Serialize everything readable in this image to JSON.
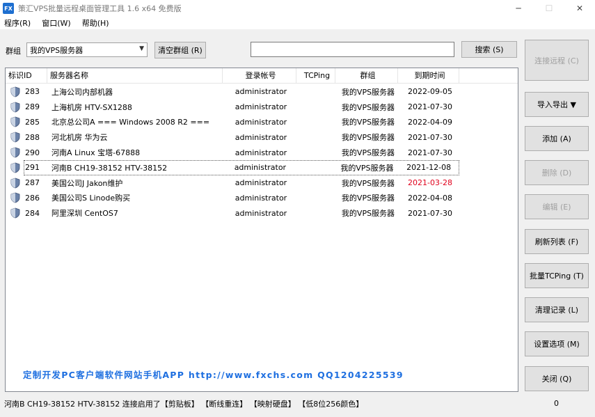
{
  "window": {
    "icon_text": "FX",
    "title": "策汇VPS批量远程桌面管理工具  1.6 x64 免费版",
    "min": "─",
    "max": "☐",
    "close": "✕"
  },
  "menu": [
    "程序(R)",
    "窗口(W)",
    "帮助(H)"
  ],
  "toolbar": {
    "group_label": "群组",
    "group_value": "我的VPS服务器",
    "clear_group": "清空群组 (R)",
    "search_value": "",
    "search_button": "搜索 (S)"
  },
  "table": {
    "columns": [
      "标识ID",
      "服务器名称",
      "登录帐号",
      "TCPing",
      "群组",
      "到期时间"
    ],
    "rows": [
      {
        "id": "283",
        "name": "上海公司内部机器",
        "account": "administrator",
        "tcping": "",
        "group": "我的VPS服务器",
        "expire": "2022-09-05",
        "expired": false
      },
      {
        "id": "289",
        "name": "上海机房  HTV-SX1288",
        "account": "administrator",
        "tcping": "",
        "group": "我的VPS服务器",
        "expire": "2021-07-30",
        "expired": false
      },
      {
        "id": "285",
        "name": "北京总公司A   === Windows 2008 R2 ===",
        "account": "administrator",
        "tcping": "",
        "group": "我的VPS服务器",
        "expire": "2022-04-09",
        "expired": false
      },
      {
        "id": "288",
        "name": "河北机房  华为云",
        "account": "administrator",
        "tcping": "",
        "group": "我的VPS服务器",
        "expire": "2021-07-30",
        "expired": false
      },
      {
        "id": "290",
        "name": "河南A   Linux 宝塔-67888",
        "account": "administrator",
        "tcping": "",
        "group": "我的VPS服务器",
        "expire": "2021-07-30",
        "expired": false
      },
      {
        "id": "291",
        "name": "河南B  CH19-38152   HTV-38152",
        "account": "administrator",
        "tcping": "",
        "group": "我的VPS服务器",
        "expire": "2021-12-08",
        "expired": false,
        "selected": true
      },
      {
        "id": "287",
        "name": "美国公司J  Jakon维护",
        "account": "administrator",
        "tcping": "",
        "group": "我的VPS服务器",
        "expire": "2021-03-28",
        "expired": true
      },
      {
        "id": "286",
        "name": "美国公司S  Linode购买",
        "account": "administrator",
        "tcping": "",
        "group": "我的VPS服务器",
        "expire": "2022-04-08",
        "expired": false
      },
      {
        "id": "284",
        "name": "阿里深圳   CentOS7",
        "account": "administrator",
        "tcping": "",
        "group": "我的VPS服务器",
        "expire": "2021-07-30",
        "expired": false
      }
    ]
  },
  "promo": "定制开发PC客户端软件网站手机APP    http://www.fxchs.com  QQ1204225539",
  "side_buttons": {
    "connect": "连接远程 (C)",
    "import_export": "导入导出 ▼",
    "add": "添加 (A)",
    "delete": "删除 (D)",
    "edit": "编辑 (E)",
    "refresh": "刷新列表 (F)",
    "tcping": "批量TCPing (T)",
    "clear_log": "清理记录 (L)",
    "settings": "设置选项 (M)",
    "close": "关闭 (Q)"
  },
  "status": {
    "text": "河南B  CH19-38152   HTV-38152 连接启用了【剪贴板】 【断线重连】 【映射硬盘】 【低8位256颜色】",
    "count": "0"
  },
  "colors": {
    "accent": "#1e6fe0",
    "expired": "#e0001b",
    "shield": "#6b82a8"
  }
}
